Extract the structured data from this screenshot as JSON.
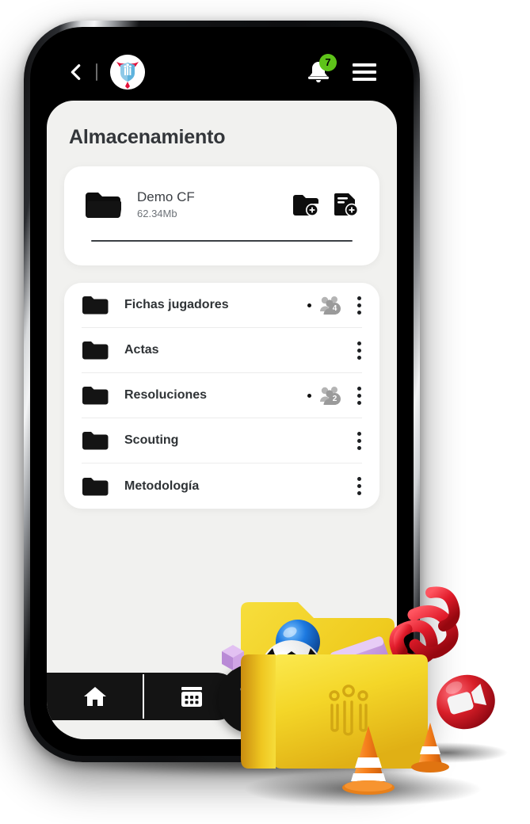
{
  "topbar": {
    "back_icon": "chevron-left-icon",
    "logo_icon": "club-crest-logo",
    "bell_icon": "notification-bell-icon",
    "notification_count": "7",
    "menu_icon": "hamburger-menu-icon",
    "badge_color": "#5EC319",
    "background": "#000000"
  },
  "page": {
    "title": "Almacenamiento",
    "background": "#F1F1EF"
  },
  "root_folder": {
    "folder_icon": "folder-icon",
    "name": "Demo CF",
    "size": "62.34Mb",
    "actions": [
      {
        "icon": "add-folder-icon",
        "name": "add-folder-button"
      },
      {
        "icon": "add-file-icon",
        "name": "add-file-button"
      }
    ]
  },
  "folders": [
    {
      "name": "Fichas jugadores",
      "shared": true,
      "share_count": "4",
      "menu_icon": "kebab-menu-icon"
    },
    {
      "name": "Actas",
      "shared": false,
      "share_count": "",
      "menu_icon": "kebab-menu-icon"
    },
    {
      "name": "Resoluciones",
      "shared": true,
      "share_count": "2",
      "menu_icon": "kebab-menu-icon"
    },
    {
      "name": "Scouting",
      "shared": false,
      "share_count": "",
      "menu_icon": "kebab-menu-icon"
    },
    {
      "name": "Metodología",
      "shared": false,
      "share_count": "",
      "menu_icon": "kebab-menu-icon"
    }
  ],
  "bottom_nav": {
    "items": [
      {
        "icon": "home-icon",
        "name": "nav-home"
      },
      {
        "icon": "calendar-icon",
        "name": "nav-calendar"
      }
    ],
    "fab": {
      "icon": "team-people-logo-icon",
      "name": "nav-team-fab"
    },
    "background": "#141414"
  },
  "illustration": {
    "name": "3d-folder-illustration",
    "elements": [
      "yellow-folder",
      "blue-sphere",
      "soccer-ball",
      "purple-cube",
      "purple-card",
      "red-whistle-spiral",
      "traffic-cone",
      "video-camera-badge"
    ],
    "folder_color": "#F5D525",
    "accent_red": "#D81E28",
    "cone_orange": "#F58220"
  }
}
